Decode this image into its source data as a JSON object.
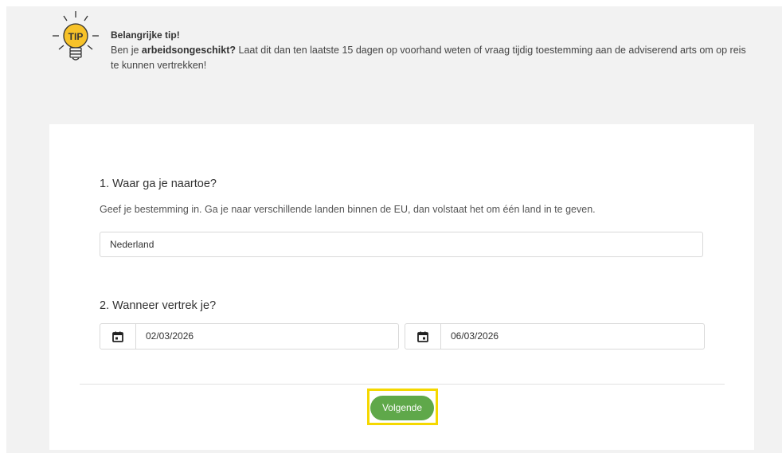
{
  "tip": {
    "badge": "TIP",
    "title": "Belangrijke tip!",
    "text_before": "Ben je ",
    "text_bold": "arbeidsongeschikt?",
    "text_after": " Laat dit dan ten laatste 15 dagen op voorhand weten of vraag tijdig toestemming aan de adviserend arts om op reis te kunnen vertrekken!",
    "icon": "lightbulb-icon"
  },
  "question1": {
    "title": "1. Waar ga je naartoe?",
    "hint": "Geef je bestemming in. Ga je naar verschillende landen binnen de EU, dan volstaat het om één land in te geven.",
    "value": "Nederland"
  },
  "question2": {
    "title": "2. Wanneer vertrek je?",
    "start_date": "02/03/2026",
    "end_date": "06/03/2026",
    "start_icon": "calendar-icon",
    "end_icon": "calendar-icon"
  },
  "footer": {
    "next_label": "Volgende"
  },
  "colors": {
    "accent": "#5fa84a",
    "highlight": "#f5d800",
    "tip_bulb": "#f7c229",
    "page_bg": "#f2f2f2"
  }
}
